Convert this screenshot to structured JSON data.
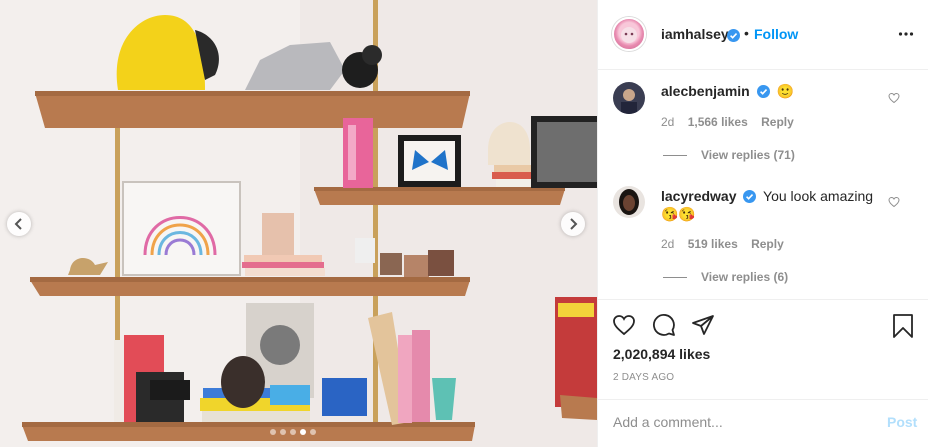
{
  "post": {
    "author": "iamhalsey",
    "separator": "•",
    "follow_label": "Follow"
  },
  "comments": [
    {
      "user": "alecbenjamin",
      "text": "",
      "emoji": "🙂",
      "age": "2d",
      "likes": "1,566 likes",
      "reply_label": "Reply",
      "view_replies": "View replies (71)"
    },
    {
      "user": "lacyredway",
      "text": "You look amazing",
      "emoji": "😘😘",
      "age": "2d",
      "likes": "519 likes",
      "reply_label": "Reply",
      "view_replies": "View replies (6)"
    }
  ],
  "stats": {
    "likes": "2,020,894 likes",
    "date": "2 DAYS AGO"
  },
  "composer": {
    "placeholder": "Add a comment...",
    "post_label": "Post"
  },
  "carousel": {
    "dot_count": 5,
    "active_index": 3
  },
  "colors": {
    "link_blue": "#0095f6",
    "post_disabled": "#b2dffc",
    "verified": "#3897f0",
    "muted": "#8e8e8e",
    "border": "#efefef"
  },
  "icons": [
    "chevron-left-icon",
    "chevron-right-icon",
    "more-icon",
    "verified-icon",
    "heart-icon",
    "comment-icon",
    "share-icon",
    "bookmark-icon"
  ]
}
